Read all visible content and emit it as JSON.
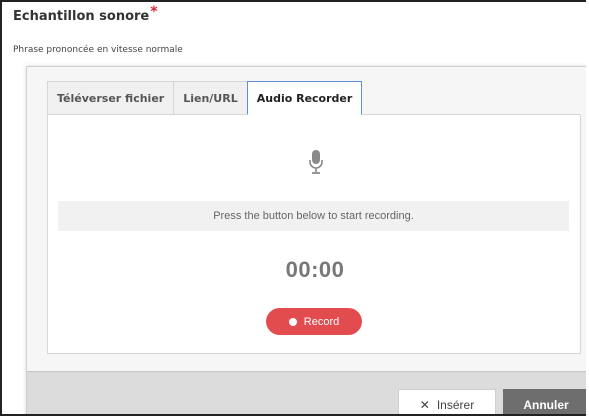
{
  "field": {
    "label": "Echantillon sonore",
    "required_mark": "*",
    "help": "Phrase prononcée en vitesse normale"
  },
  "tabs": [
    {
      "label": "Téléverser fichier",
      "active": false
    },
    {
      "label": "Lien/URL",
      "active": false
    },
    {
      "label": "Audio Recorder",
      "active": true
    }
  ],
  "recorder": {
    "icon": "microphone-icon",
    "status": "Press the button below to start recording.",
    "timer": "00:00",
    "record_label": "Record"
  },
  "footer": {
    "insert_icon": "close-x-icon",
    "insert_label": "Insérer",
    "cancel_label": "Annuler"
  },
  "colors": {
    "record_button": "#e24c4f",
    "active_tab_border": "#5b8fd6",
    "required_mark": "#d9262c",
    "cancel_button": "#6e6e6e"
  }
}
